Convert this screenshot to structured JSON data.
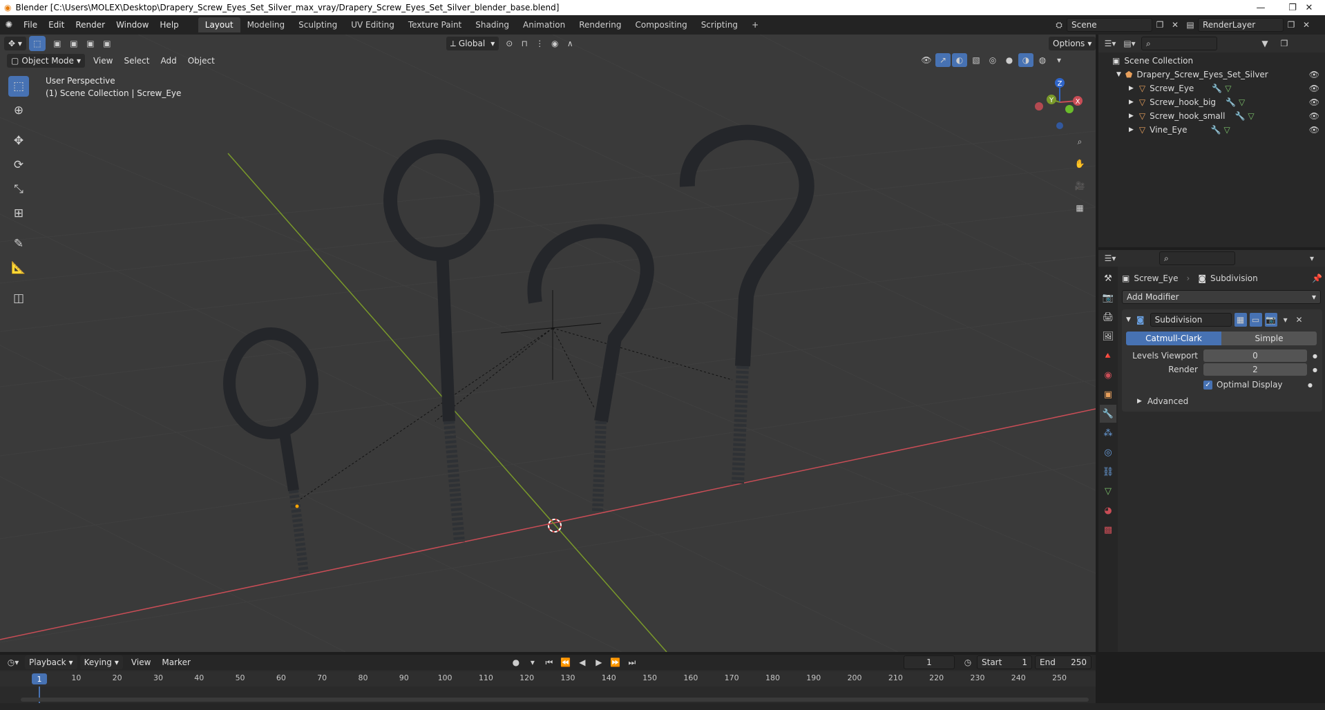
{
  "window": {
    "title": "Blender [C:\\Users\\MOLEX\\Desktop\\Drapery_Screw_Eyes_Set_Silver_max_vray/Drapery_Screw_Eyes_Set_Silver_blender_base.blend]",
    "min_glyph": "—",
    "restore_glyph": "❐",
    "close_glyph": "✕"
  },
  "menu": [
    "File",
    "Edit",
    "Render",
    "Window",
    "Help"
  ],
  "workspaces": [
    "Layout",
    "Modeling",
    "Sculpting",
    "UV Editing",
    "Texture Paint",
    "Shading",
    "Animation",
    "Rendering",
    "Compositing",
    "Scripting"
  ],
  "workspace_add": "+",
  "scene": {
    "scene_name": "Scene",
    "render_layer": "RenderLayer"
  },
  "viewport_header": {
    "transform_orientation": "Global",
    "options_label": "Options",
    "mode": "Object Mode",
    "menus": [
      "View",
      "Select",
      "Add",
      "Object"
    ]
  },
  "viewport": {
    "perspective_label": "User Perspective",
    "collection_label": "(1) Scene Collection | Screw_Eye",
    "gizmo": {
      "z": "Z",
      "y": "Y",
      "x": "X"
    }
  },
  "outliner": {
    "root": "Scene Collection",
    "collection": "Drapery_Screw_Eyes_Set_Silver",
    "objects": [
      "Screw_Eye",
      "Screw_hook_big",
      "Screw_hook_small",
      "Vine_Eye"
    ]
  },
  "properties": {
    "object_name": "Screw_Eye",
    "modifier_crumb": "Subdivision",
    "add_modifier": "Add Modifier",
    "modifier_name": "Subdivision",
    "type_catmull": "Catmull-Clark",
    "type_simple": "Simple",
    "levels_viewport_label": "Levels Viewport",
    "levels_viewport_value": "0",
    "render_label": "Render",
    "render_value": "2",
    "optimal_display_label": "Optimal Display",
    "advanced_label": "Advanced"
  },
  "timeline": {
    "menus": [
      "Playback",
      "Keying",
      "View",
      "Marker"
    ],
    "current_frame": "1",
    "start_label": "Start",
    "start_value": "1",
    "end_label": "End",
    "end_value": "250",
    "ruler_current": "1",
    "ruler_ticks": [
      "10",
      "20",
      "30",
      "40",
      "50",
      "60",
      "70",
      "80",
      "90",
      "100",
      "110",
      "120",
      "130",
      "140",
      "150",
      "160",
      "170",
      "180",
      "190",
      "200",
      "210",
      "220",
      "230",
      "240",
      "250"
    ]
  },
  "colors": {
    "accent": "#4772b3",
    "x_axis": "#c94d56",
    "y_axis": "#7a9a2a",
    "header": "#303030"
  }
}
